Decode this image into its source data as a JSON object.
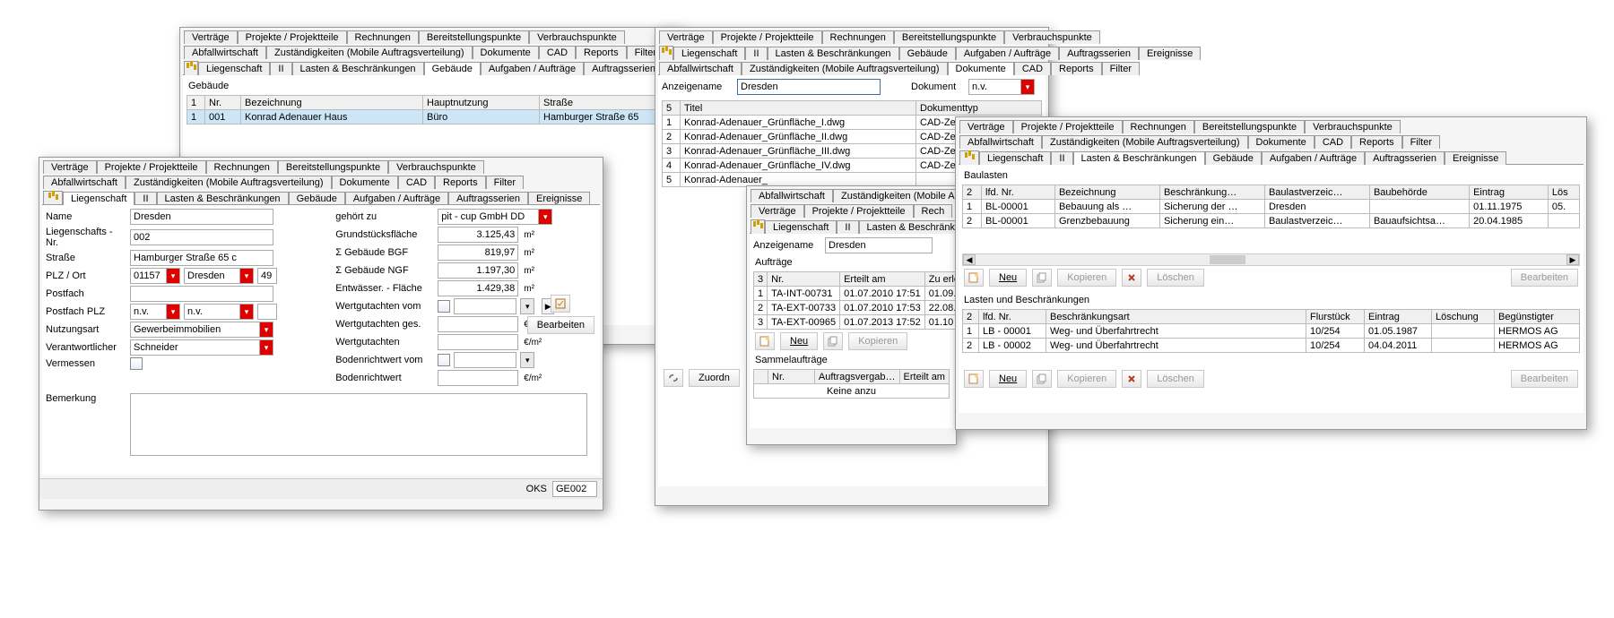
{
  "tabLabels": {
    "vertraege": "Verträge",
    "projekte": "Projekte / Projektteile",
    "rechnungen": "Rechnungen",
    "bereitstellung": "Bereitstellungspunkte",
    "verbrauch": "Verbrauchspunkte",
    "abfall": "Abfallwirtschaft",
    "zustaendig": "Zuständigkeiten (Mobile Auftragsverteilung)",
    "dokumente": "Dokumente",
    "cad": "CAD",
    "reports": "Reports",
    "filter": "Filter",
    "liegenschaft": "Liegenschaft",
    "ii": "II",
    "lasten": "Lasten & Beschränkungen",
    "gebaeude": "Gebäude",
    "aufgaben": "Aufgaben / Aufträge",
    "auftragsserien": "Auftragsserien",
    "ereignisse": "Ereignisse",
    "rech": "Rech"
  },
  "buttons": {
    "neu": "Neu",
    "kopieren": "Kopieren",
    "loeschen": "Löschen",
    "bearbeiten": "Bearbeiten",
    "zuordnen": "Zuordn"
  },
  "win_gebaeude": {
    "section": "Gebäude",
    "headers": {
      "c1": "1",
      "c2": "Nr.",
      "c3": "Bezeichnung",
      "c4": "Hauptnutzung",
      "c5": "Straße"
    },
    "row": {
      "n": "1",
      "nr": "001",
      "bez": "Konrad Adenauer Haus",
      "nutz": "Büro",
      "str": "Hamburger Straße 65"
    }
  },
  "win_liegenschaft": {
    "labels": {
      "name": "Name",
      "lnr": "Liegenschafts - Nr.",
      "strasse": "Straße",
      "plzort": "PLZ / Ort",
      "postfach": "Postfach",
      "postfachplz": "Postfach PLZ",
      "nutzungsart": "Nutzungsart",
      "verantwortlicher": "Verantwortlicher",
      "vermessen": "Vermessen",
      "bemerkung": "Bemerkung",
      "gehoertzu": "gehört zu",
      "grundfl": "Grundstücksfläche",
      "bgf": "Σ Gebäude BGF",
      "ngf": "Σ Gebäude NGF",
      "entw": "Entwässer. - Fläche",
      "wgvom": "Wertgutachten vom",
      "wgges": "Wertgutachten ges.",
      "wg": "Wertgutachten",
      "brvom": "Bodenrichtwert vom",
      "br": "Bodenrichtwert"
    },
    "values": {
      "name": "Dresden",
      "lnr": "002",
      "strasse": "Hamburger Straße 65 c",
      "plz": "01157",
      "ort": "Dresden",
      "ortcode": "49",
      "pfplz_a": "n.v.",
      "pfplz_b": "n.v.",
      "nutzung": "Gewerbeimmobilien",
      "verantw": "Schneider",
      "gehoertzu": "pit - cup GmbH DD",
      "grundfl": "3.125,43",
      "bgf": "819,97",
      "ngf": "1.197,30",
      "entw": "1.429,38"
    },
    "units": {
      "m2": "m²",
      "eur": "€",
      "eurm2": "€/m²"
    },
    "footer": {
      "oks": "OKS",
      "val": "GE002"
    }
  },
  "win_dokumente": {
    "labels": {
      "anzeigename": "Anzeigename",
      "dokument": "Dokument"
    },
    "values": {
      "anzeigename": "Dresden",
      "dokument": "n.v."
    },
    "headers": {
      "c1": "5",
      "c2": "Titel",
      "c3": "Dokumenttyp"
    },
    "rows": [
      {
        "n": "1",
        "t": "Konrad-Adenauer_Grünfläche_I.dwg",
        "d": "CAD-Zeichnung (Grun"
      },
      {
        "n": "2",
        "t": "Konrad-Adenauer_Grünfläche_II.dwg",
        "d": "CAD-Zeichnung (Grun"
      },
      {
        "n": "3",
        "t": "Konrad-Adenauer_Grünfläche_III.dwg",
        "d": "CAD-Zeichnung (Grun"
      },
      {
        "n": "4",
        "t": "Konrad-Adenauer_Grünfläche_IV.dwg",
        "d": "CAD-Zeichnung (Grun"
      },
      {
        "n": "5",
        "t": "Konrad-Adenauer_",
        "d": ""
      }
    ]
  },
  "win_auftraege": {
    "anzeigename_label": "Anzeigename",
    "anzeigename": "Dresden",
    "section1": "Aufträge",
    "section2": "Sammelaufträge",
    "keine": "Keine anzu",
    "h1": {
      "c1": "3",
      "c2": "Nr.",
      "c3": "Erteilt am",
      "c4": "Zu erle"
    },
    "r1": {
      "n": "1",
      "nr": "TA-INT-00731",
      "e": "01.07.2010 17:51",
      "z": "01.09."
    },
    "r2": {
      "n": "2",
      "nr": "TA-EXT-00733",
      "e": "01.07.2010 17:53",
      "z": "22.08."
    },
    "r3": {
      "n": "3",
      "nr": "TA-EXT-00965",
      "e": "01.07.2013 17:52",
      "z": "01.10"
    },
    "h2": {
      "c1": "",
      "c2": "Nr.",
      "c3": "Auftragsvergab…",
      "c4": "Erteilt am"
    }
  },
  "win_baulasten": {
    "section1": "Baulasten",
    "section2": "Lasten und Beschränkungen",
    "h1": {
      "c1": "2",
      "c2": "lfd. Nr.",
      "c3": "Bezeichnung",
      "c4": "Beschränkung…",
      "c5": "Baulastverzeic…",
      "c6": "Baubehörde",
      "c7": "Eintrag",
      "c8": "Lös"
    },
    "b1": {
      "n": "1",
      "nr": "BL-00001",
      "bez": "Bebauung als …",
      "be": "Sicherung der …",
      "blv": "Dresden",
      "beh": "",
      "ein": "01.11.1975",
      "lo": "05."
    },
    "b2": {
      "n": "2",
      "nr": "BL-00001",
      "bez": "Grenzbebauung",
      "be": "Sicherung ein…",
      "blv": "Baulastverzeic…",
      "beh": "Bauaufsichtsa…",
      "ein": "20.04.1985",
      "lo": ""
    },
    "h2": {
      "c1": "2",
      "c2": "lfd. Nr.",
      "c3": "Beschränkungsart",
      "c4": "Flurstück",
      "c5": "Eintrag",
      "c6": "Löschung",
      "c7": "Begünstigter"
    },
    "l1": {
      "n": "1",
      "nr": "LB - 00001",
      "art": "Weg- und Überfahrtrecht",
      "fl": "10/254",
      "ein": "01.05.1987",
      "lo": "",
      "beg": "HERMOS AG"
    },
    "l2": {
      "n": "2",
      "nr": "LB - 00002",
      "art": "Weg- und Überfahrtrecht",
      "fl": "10/254",
      "ein": "04.04.2011",
      "lo": "",
      "beg": "HERMOS AG"
    }
  }
}
